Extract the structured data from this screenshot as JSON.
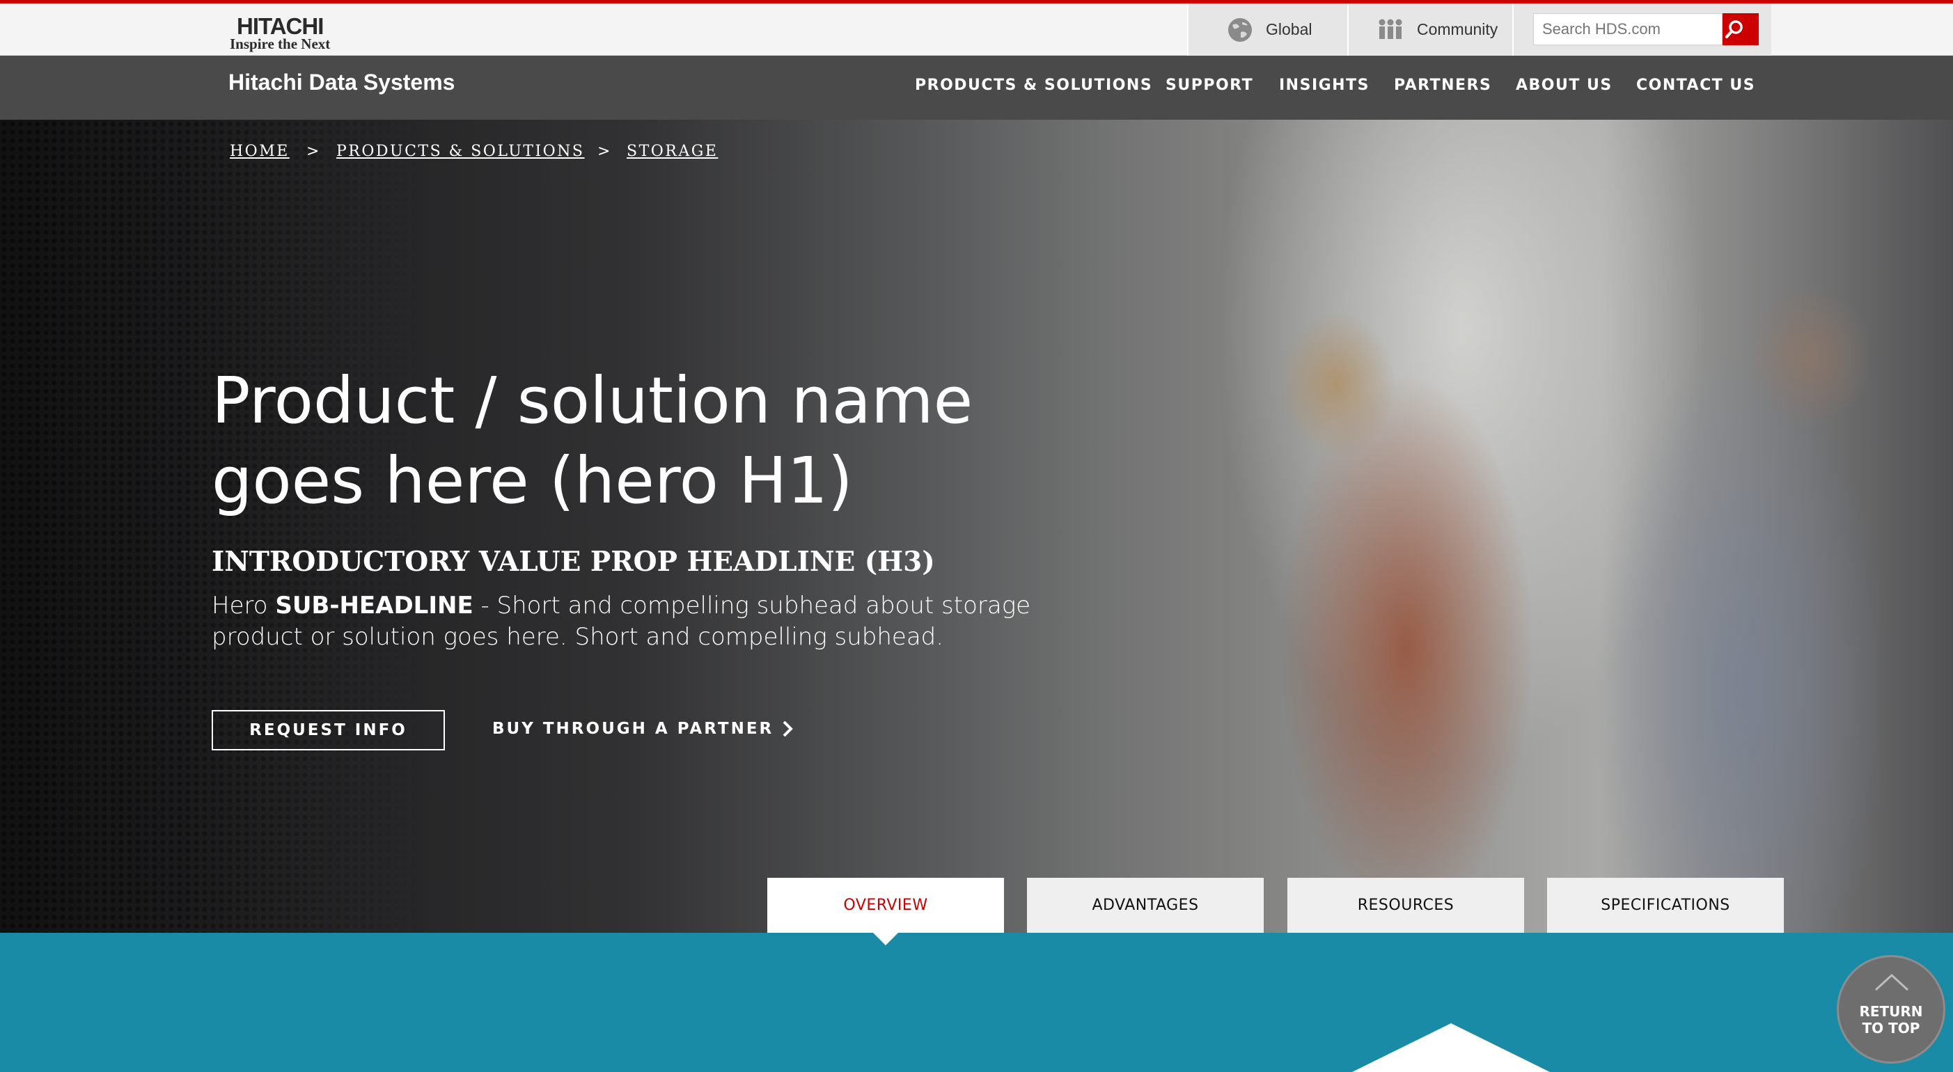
{
  "topbar": {
    "logo_main": "HITACHI",
    "logo_tagline": "Inspire the Next",
    "global_label": "Global",
    "community_label": "Community",
    "search_placeholder": "Search HDS.com",
    "accent_color": "#cc0000"
  },
  "navbar": {
    "brand": "Hitachi Data Systems",
    "items": [
      "PRODUCTS & SOLUTIONS",
      "SUPPORT",
      "INSIGHTS",
      "PARTNERS",
      "ABOUT US",
      "CONTACT US"
    ]
  },
  "breadcrumb": {
    "items": [
      "HOME",
      "PRODUCTS & SOLUTIONS",
      "STORAGE"
    ],
    "separator": ">"
  },
  "hero": {
    "title": "Product / solution name goes here (hero H1)",
    "h3": "INTRODUCTORY VALUE PROP HEADLINE (H3)",
    "sub_prefix": "Hero ",
    "sub_bold": "SUB-HEADLINE",
    "sub_rest": " - Short and compelling subhead about storage product or solution goes here. Short and compelling subhead.",
    "request_label": "REQUEST INFO",
    "partner_label": "BUY THROUGH A PARTNER"
  },
  "tabs": {
    "items": [
      "OVERVIEW",
      "ADVANTAGES",
      "RESOURCES",
      "SPECIFICATIONS"
    ],
    "active": "OVERVIEW"
  },
  "return_to_top": {
    "line1": "RETURN",
    "line2": "TO TOP"
  },
  "colors": {
    "teal_band": "#1a8ba6",
    "nav_bg": "#4a4a4a",
    "topbar_bg": "#f4f4f4"
  },
  "icons": [
    "globe-icon",
    "community-icon",
    "search-icon",
    "chevron-right-icon",
    "chevron-up-icon"
  ]
}
